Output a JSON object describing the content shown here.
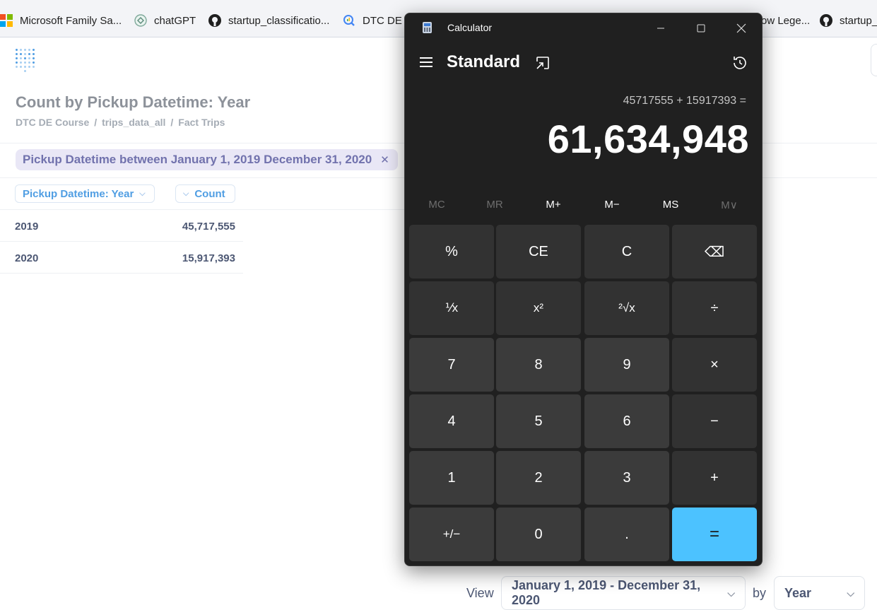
{
  "bookmarks": [
    {
      "label": "Microsoft Family Sa...",
      "icon": "microsoft-icon"
    },
    {
      "label": "chatGPT",
      "icon": "openai-icon"
    },
    {
      "label": "startup_classificatio...",
      "icon": "github-icon"
    },
    {
      "label": "DTC DE C",
      "icon": "search-analytics-icon"
    },
    {
      "label": "ow Lege...",
      "icon": "page-icon"
    },
    {
      "label": "startup_",
      "icon": "github-icon"
    }
  ],
  "question": {
    "title": "Count by Pickup Datetime: Year",
    "breadcrumbs": [
      "DTC DE Course",
      "trips_data_all",
      "Fact Trips"
    ],
    "filter": "Pickup Datetime between January 1, 2019 December 31, 2020",
    "columns": [
      "Pickup Datetime: Year",
      "Count"
    ],
    "rows": [
      {
        "year": "2019",
        "count": "45,717,555"
      },
      {
        "year": "2020",
        "count": "15,917,393"
      }
    ],
    "footer": {
      "view_label": "View",
      "date_range": "January 1, 2019 - December 31, 2020",
      "by_label": "by",
      "granularity": "Year"
    }
  },
  "calculator": {
    "window_title": "Calculator",
    "mode": "Standard",
    "expression": "45717555 + 15917393 =",
    "result": "61,634,948",
    "memory": [
      "MC",
      "MR",
      "M+",
      "M−",
      "MS",
      "M∨"
    ],
    "keys": [
      [
        "%",
        "CE",
        "C",
        "⌫"
      ],
      [
        "⅟x",
        "x²",
        "²√x",
        "÷"
      ],
      [
        "7",
        "8",
        "9",
        "×"
      ],
      [
        "4",
        "5",
        "6",
        "−"
      ],
      [
        "1",
        "2",
        "3",
        "+"
      ],
      [
        "+/−",
        "0",
        ".",
        "="
      ]
    ],
    "accent_color": "#4cc2ff"
  }
}
